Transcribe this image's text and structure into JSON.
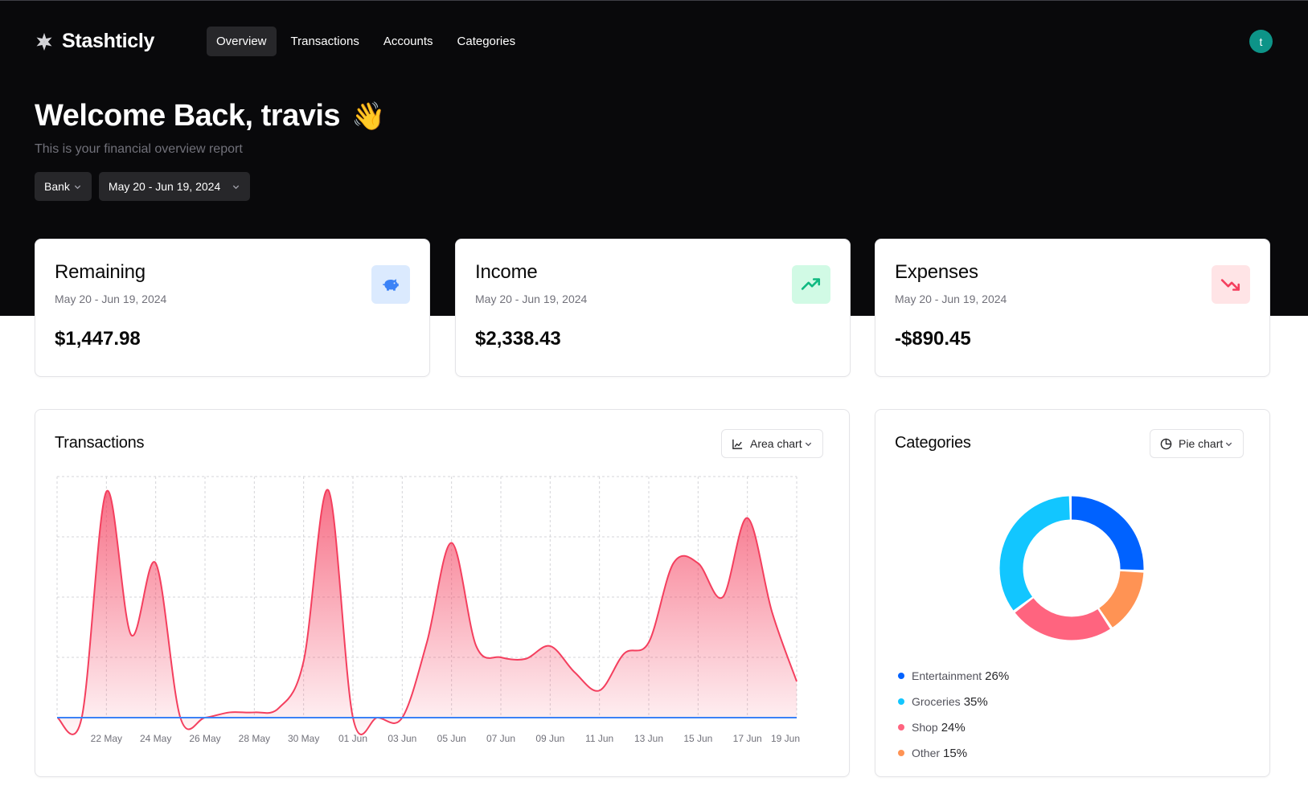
{
  "app": {
    "name": "Stashticly"
  },
  "nav": {
    "items": [
      {
        "label": "Overview",
        "active": true
      },
      {
        "label": "Transactions"
      },
      {
        "label": "Accounts"
      },
      {
        "label": "Categories"
      }
    ]
  },
  "user": {
    "initial": "t"
  },
  "hero": {
    "greeting": "Welcome Back, travis",
    "emoji": "👋",
    "subtitle": "This is your financial overview report",
    "account_filter": "Bank",
    "date_filter": "May 20 - Jun 19, 2024"
  },
  "stats": [
    {
      "title": "Remaining",
      "date": "May 20 - Jun 19, 2024",
      "value": "$1,447.98",
      "icon": "piggy-bank-icon",
      "icon_bg": "#dbeafe",
      "icon_color": "#3b82f6"
    },
    {
      "title": "Income",
      "date": "May 20 - Jun 19, 2024",
      "value": "$2,338.43",
      "icon": "trending-up-icon",
      "icon_bg": "#d1fae5",
      "icon_color": "#10b981"
    },
    {
      "title": "Expenses",
      "date": "May 20 - Jun 19, 2024",
      "value": "-$890.45",
      "icon": "trending-down-icon",
      "icon_bg": "#ffe4e6",
      "icon_color": "#f43f5e"
    }
  ],
  "transactions_panel": {
    "title": "Transactions",
    "chart_type_label": "Area chart"
  },
  "categories_panel": {
    "title": "Categories",
    "chart_type_label": "Pie chart"
  },
  "chart_data": [
    {
      "type": "area",
      "x": [
        "20 May",
        "21 May",
        "22 May",
        "23 May",
        "24 May",
        "25 May",
        "26 May",
        "27 May",
        "28 May",
        "29 May",
        "30 May",
        "31 May",
        "01 Jun",
        "02 Jun",
        "03 Jun",
        "04 Jun",
        "05 Jun",
        "06 Jun",
        "07 Jun",
        "08 Jun",
        "09 Jun",
        "10 Jun",
        "11 Jun",
        "12 Jun",
        "13 Jun",
        "14 Jun",
        "15 Jun",
        "16 Jun",
        "17 Jun",
        "18 Jun",
        "19 Jun"
      ],
      "tick_labels": [
        "22 May",
        "24 May",
        "26 May",
        "28 May",
        "30 May",
        "01 Jun",
        "03 Jun",
        "05 Jun",
        "07 Jun",
        "09 Jun",
        "11 Jun",
        "13 Jun",
        "15 Jun",
        "17 Jun",
        "19 Jun"
      ],
      "series": [
        {
          "values": [
            0,
            0,
            300,
            110,
            205,
            0,
            0,
            7,
            7,
            13,
            75,
            302,
            0,
            0,
            0,
            100,
            232,
            95,
            80,
            78,
            95,
            60,
            36,
            85,
            100,
            205,
            205,
            160,
            265,
            140,
            48
          ],
          "color": "#f43f5e"
        },
        {
          "values": [
            0,
            0,
            0,
            0,
            0,
            0,
            0,
            0,
            0,
            0,
            0,
            0,
            0,
            0,
            0,
            0,
            0,
            0,
            0,
            0,
            0,
            0,
            0,
            0,
            0,
            0,
            0,
            0,
            0,
            0,
            0
          ],
          "color": "#3b82f6"
        }
      ],
      "grid": true
    },
    {
      "type": "pie",
      "donut": true,
      "series": [
        {
          "name": "Entertainment",
          "value": 26,
          "label": "26%",
          "color": "#0062ff"
        },
        {
          "name": "Other",
          "value": 15,
          "label": "15%",
          "color": "#ff9354"
        },
        {
          "name": "Shop",
          "value": 24,
          "label": "24%",
          "color": "#ff647f"
        },
        {
          "name": "Groceries",
          "value": 35,
          "label": "35%",
          "color": "#12c6ff"
        }
      ]
    }
  ]
}
